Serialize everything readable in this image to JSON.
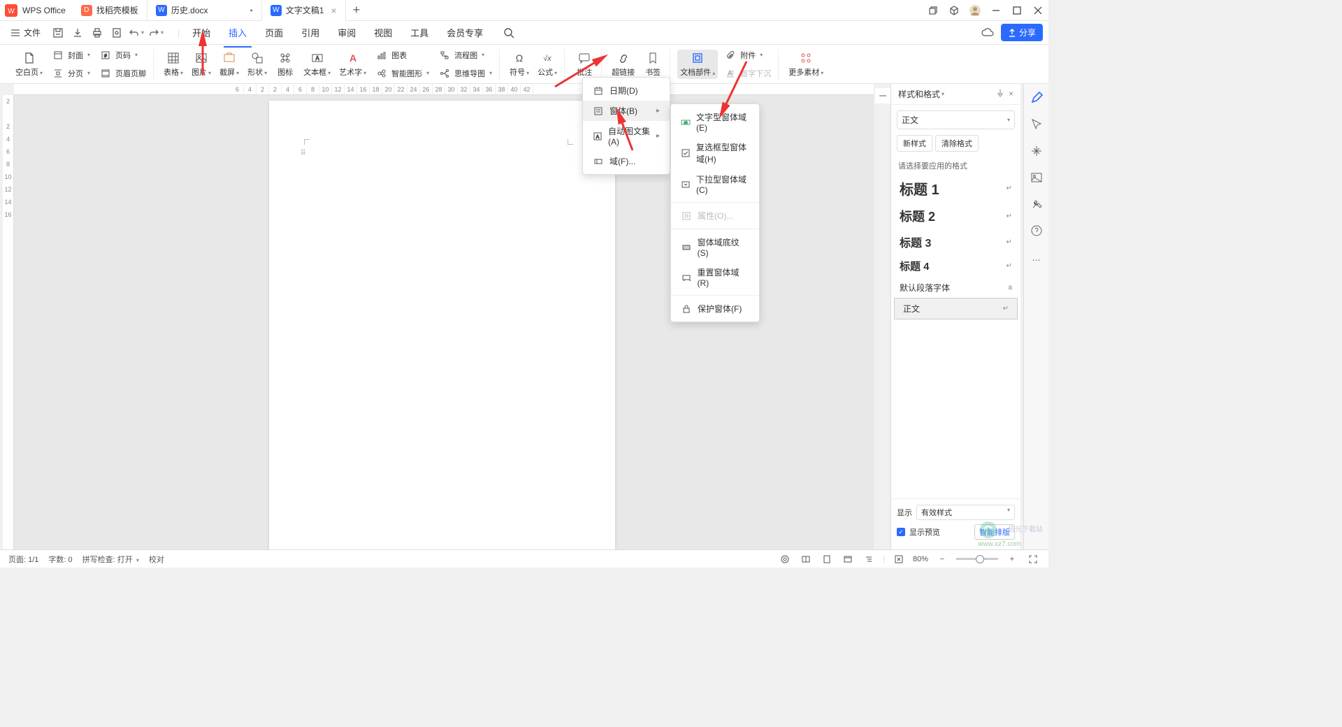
{
  "app": {
    "name": "WPS Office"
  },
  "tabs": [
    {
      "icon_bg": "#ff6a4d",
      "icon_text": "D",
      "label": "找稻壳模板"
    },
    {
      "icon_bg": "#2b6aff",
      "icon_text": "W",
      "label": "历史.docx",
      "modified": "•"
    },
    {
      "icon_bg": "#2b6aff",
      "icon_text": "W",
      "label": "文字文稿1",
      "close": "×"
    }
  ],
  "menubar": {
    "file": "文件",
    "items": [
      "开始",
      "插入",
      "页面",
      "引用",
      "审阅",
      "视图",
      "工具",
      "会员专享"
    ],
    "active_index": 1,
    "share": "分享"
  },
  "ribbon": {
    "blank": "空白页",
    "cover": "封面",
    "pagenum": "页码",
    "section": "分页",
    "headerfooter": "页眉页脚",
    "table": "表格",
    "picture": "图片",
    "screenshot": "截屏",
    "shape": "形状",
    "icon": "图标",
    "textbox": "文本框",
    "wordart": "艺术字",
    "chart": "图表",
    "smartart": "智能图形",
    "flowchart": "流程图",
    "mindmap": "思维导图",
    "symbol": "符号",
    "equation": "公式",
    "comment": "批注",
    "hyperlink": "超链接",
    "bookmark": "书签",
    "docparts": "文档部件",
    "attachment": "附件",
    "dropcap": "首字下沉",
    "more": "更多素材"
  },
  "ruler_top_left": [
    "6",
    "4",
    "2"
  ],
  "ruler_top": [
    "2",
    "4",
    "6",
    "8",
    "10",
    "12",
    "14",
    "16",
    "18",
    "20",
    "22",
    "24",
    "26",
    "28",
    "30",
    "32",
    "34",
    "36",
    "38",
    "40",
    "42"
  ],
  "vruler": [
    "2",
    "",
    "2",
    "4",
    "6",
    "8",
    "10",
    "12",
    "14",
    "16",
    "",
    "",
    "",
    "",
    "",
    "",
    "",
    "",
    "",
    "",
    "",
    "",
    "",
    "",
    "",
    "",
    "",
    "",
    "",
    "",
    "",
    "",
    "",
    "",
    "",
    ""
  ],
  "dropdown1": {
    "date": "日期(D)",
    "form": "窗体(B)",
    "autotext": "自动图文集(A)",
    "field": "域(F)..."
  },
  "dropdown2": {
    "text_form": "文字型窗体域(E)",
    "checkbox_form": "复选框型窗体域(H)",
    "dropdown_form": "下拉型窗体域(C)",
    "properties": "属性(O)...",
    "shading": "窗体域底纹(S)",
    "reset": "重置窗体域(R)",
    "protect": "保护窗体(F)"
  },
  "styles_panel": {
    "title": "样式和格式",
    "current": "正文",
    "new_btn": "新样式",
    "clear_btn": "清除格式",
    "instruction": "请选择要应用的格式",
    "styles": [
      {
        "name": "标题 1",
        "cls": "sp-h1"
      },
      {
        "name": "标题 2",
        "cls": "sp-h2"
      },
      {
        "name": "标题 3",
        "cls": "sp-h3"
      },
      {
        "name": "标题 4",
        "cls": "sp-h4"
      },
      {
        "name": "默认段落字体",
        "cls": ""
      },
      {
        "name": "正文",
        "cls": "",
        "selected": true
      }
    ],
    "show_label": "显示",
    "show_value": "有效样式",
    "preview_label": "显示预览",
    "smart_layout": "智能排版"
  },
  "statusbar": {
    "page": "页面: 1/1",
    "words": "字数: 0",
    "spell": "拼写检查: 打开",
    "proof": "校对",
    "zoom": "80%"
  },
  "watermark": {
    "line1": "极光下载站",
    "line2": "www.xz7.com"
  }
}
